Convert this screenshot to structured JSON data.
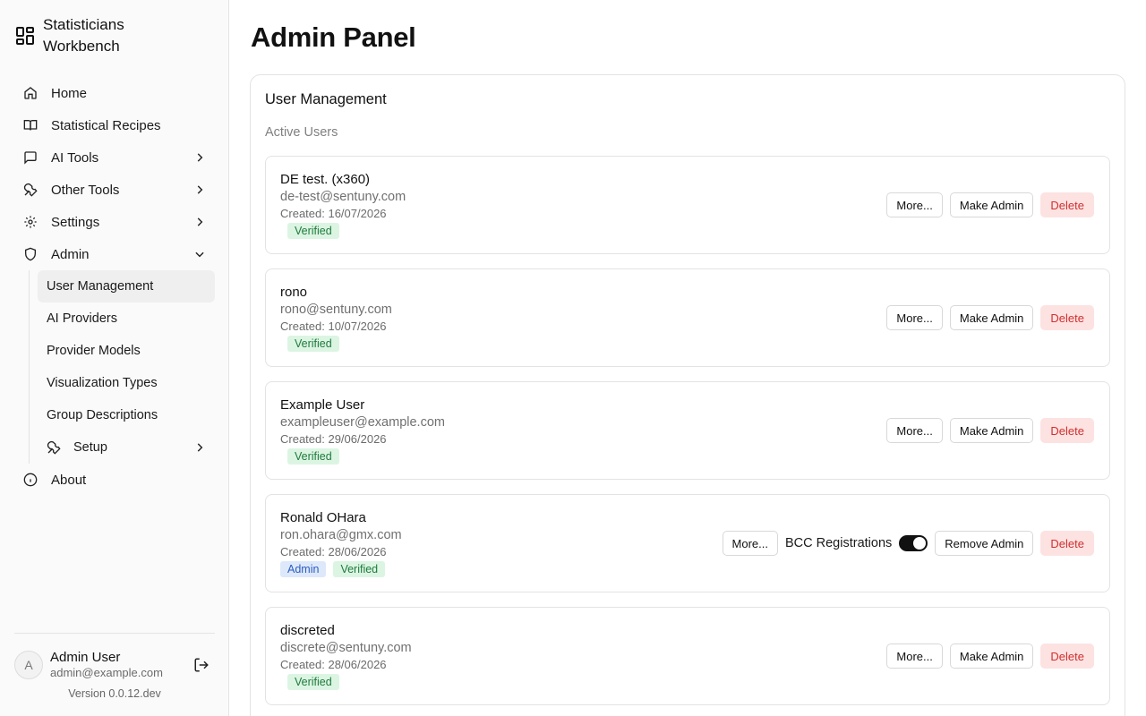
{
  "app": {
    "name": "Statisticians Workbench"
  },
  "sidebar": {
    "items": [
      {
        "label": "Home",
        "icon": "home-icon"
      },
      {
        "label": "Statistical Recipes",
        "icon": "book-icon"
      },
      {
        "label": "AI Tools",
        "icon": "chat-icon"
      },
      {
        "label": "Other Tools",
        "icon": "wrench-icon"
      },
      {
        "label": "Settings",
        "icon": "gear-icon"
      },
      {
        "label": "Admin",
        "icon": "shield-icon"
      },
      {
        "label": "About",
        "icon": "info-icon"
      }
    ],
    "admin_sub": [
      {
        "label": "User Management"
      },
      {
        "label": "AI Providers"
      },
      {
        "label": "Provider Models"
      },
      {
        "label": "Visualization Types"
      },
      {
        "label": "Group Descriptions"
      },
      {
        "label": "Setup"
      }
    ]
  },
  "footer": {
    "avatar_initial": "A",
    "user_name": "Admin User",
    "user_email": "admin@example.com",
    "version": "Version 0.0.12.dev"
  },
  "main": {
    "title": "Admin Panel",
    "card_title": "User Management",
    "card_subtitle": "Active Users",
    "buttons": {
      "more": "More...",
      "make_admin": "Make Admin",
      "remove_admin": "Remove Admin",
      "delete": "Delete",
      "bcc": "BCC Registrations"
    },
    "users": [
      {
        "name": "DE test. (x360)",
        "email": "de-test@sentuny.com",
        "created": "Created: 16/07/2026",
        "admin_badge": "",
        "verified_badge": "Verified"
      },
      {
        "name": "rono",
        "email": "rono@sentuny.com",
        "created": "Created: 10/07/2026",
        "admin_badge": "",
        "verified_badge": "Verified"
      },
      {
        "name": "Example User",
        "email": "exampleuser@example.com",
        "created": "Created: 29/06/2026",
        "admin_badge": "",
        "verified_badge": "Verified"
      },
      {
        "name": "Ronald OHara",
        "email": "ron.ohara@gmx.com",
        "created": "Created: 28/06/2026",
        "admin_badge": "Admin",
        "verified_badge": "Verified"
      },
      {
        "name": "discreted",
        "email": "discrete@sentuny.com",
        "created": "Created: 28/06/2026",
        "admin_badge": "",
        "verified_badge": "Verified"
      }
    ]
  },
  "colors": {
    "delete_bg": "#fde2e2",
    "delete_text": "#d0302f",
    "verified_bg": "#dcf5e3",
    "admin_bg": "#dde9fb",
    "toggle_on": "#111111"
  }
}
